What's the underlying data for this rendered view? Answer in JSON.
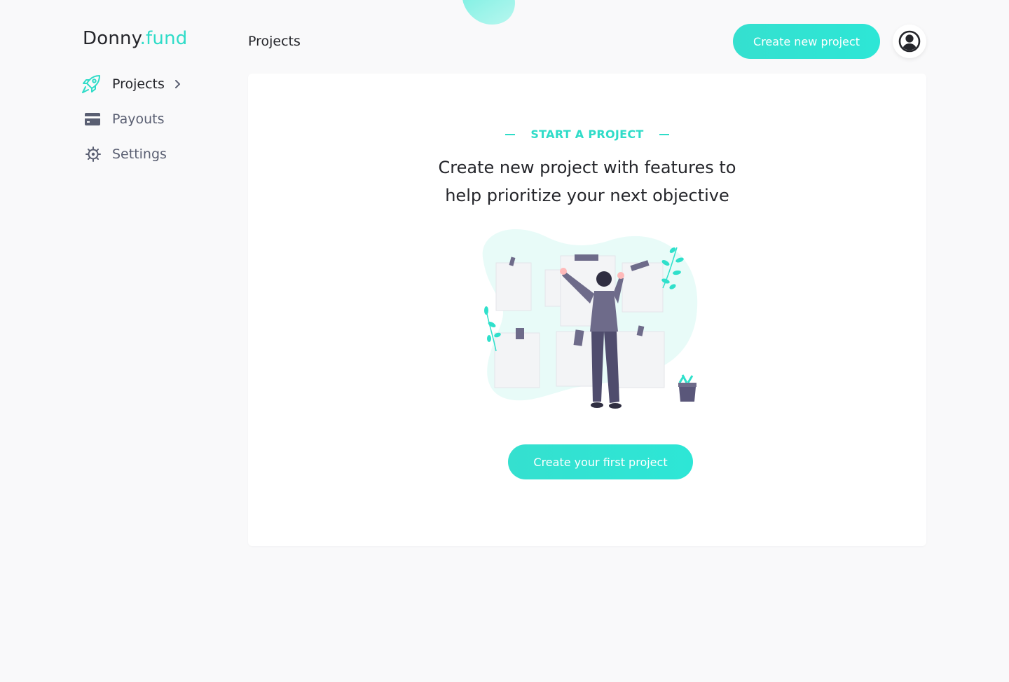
{
  "app": {
    "logo_main": "Donny",
    "logo_accent": ".fund",
    "brand_color": "#2fdcc8"
  },
  "sidebar": {
    "items": [
      {
        "label": "Projects",
        "icon": "rocket-icon",
        "active": true
      },
      {
        "label": "Payouts",
        "icon": "credit-card-icon",
        "active": false
      },
      {
        "label": "Settings",
        "icon": "gear-icon",
        "active": false
      }
    ]
  },
  "header": {
    "title": "Projects",
    "create_button_label": "Create new project",
    "avatar_icon": "user-avatar-icon"
  },
  "empty_state": {
    "eyebrow": "START A PROJECT",
    "heading_line1": "Create new project with features to",
    "heading_line2": "help prioritize your next objective",
    "illustration": "man-arranging-notes-illustration",
    "cta_label": "Create your first project"
  }
}
